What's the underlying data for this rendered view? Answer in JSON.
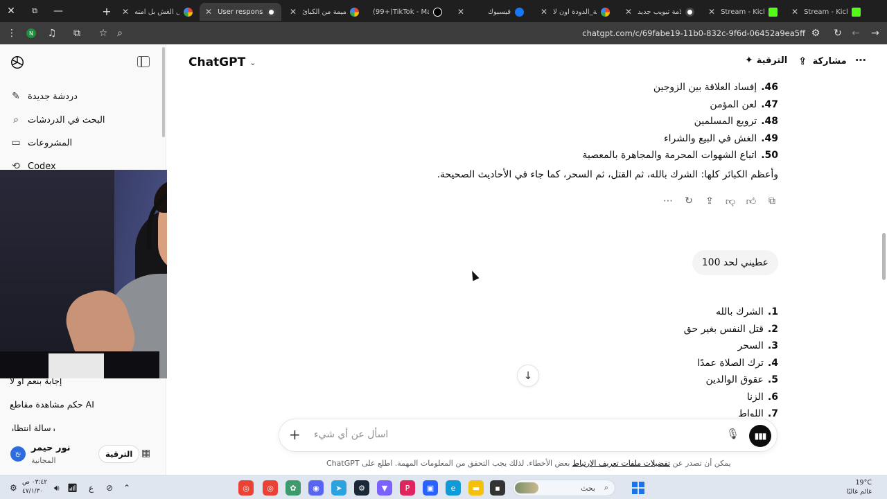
{
  "browser": {
    "close_window_icon": "✕",
    "tabs": [
      {
        "label": "هل الغش بل امته",
        "icon": "g",
        "active": false
      },
      {
        "label": "User response cl",
        "icon": "c",
        "active": true
      },
      {
        "label": "التميمة من الكبائ",
        "icon": "g",
        "active": false
      },
      {
        "label": "(99+)TikTok - Ma",
        "icon": "t",
        "active": false
      },
      {
        "label": "فيسبوك",
        "icon": "f",
        "active": false
      },
      {
        "label": "لعبة_الدودة اون لا",
        "icon": "g",
        "active": false
      },
      {
        "label": "علامة تبويب جديد",
        "icon": "c",
        "active": false
      },
      {
        "label": "Stream - Kick Da",
        "icon": "k",
        "active": false
      },
      {
        "label": "Stream - Kick Da",
        "icon": "k",
        "active": false
      }
    ],
    "url": "chatgpt.com/c/69fabe19-11b0-832c-9f6d-06452a9ea5ff",
    "profile_letter": "N"
  },
  "sidebar": {
    "items": [
      {
        "label": "دردشة جديدة",
        "icon": "✎"
      },
      {
        "label": "البحث في الدردشات",
        "icon": "⌕"
      },
      {
        "label": "المشروعات",
        "icon": "▭"
      },
      {
        "label": "Codex",
        "icon": "⟲"
      }
    ],
    "chats": [
      "إجابة بنعم او لا",
      "حكم مشاهدة مقاطع AI",
      "رسالة انتظار"
    ],
    "user": {
      "name": "نور حيمر",
      "plan": "المجانية",
      "initials": "نح"
    },
    "upgrade_label": "الترقية"
  },
  "header": {
    "model": "ChatGPT",
    "upgrade_label": "الترقية",
    "share_label": "مشاركة"
  },
  "conversation": {
    "list_top": [
      {
        "num": "46.",
        "text": "إفساد العلاقة بين الزوجين"
      },
      {
        "num": "47.",
        "text": "لعن المؤمن"
      },
      {
        "num": "48.",
        "text": "ترويع المسلمين"
      },
      {
        "num": "49.",
        "text": "الغش في البيع والشراء"
      },
      {
        "num": "50.",
        "text": "اتباع الشهوات المحرمة والمجاهرة بالمعصية"
      }
    ],
    "summary": "وأعظم الكبائر كلها: الشرك بالله، ثم القتل، ثم السحر، كما جاء في الأحاديث الصحيحة.",
    "user_message": "عطيني لحد 100",
    "list_bottom": [
      {
        "num": "1.",
        "text": "الشرك بالله"
      },
      {
        "num": "2.",
        "text": "قتل النفس بغير حق"
      },
      {
        "num": "3.",
        "text": "السحر"
      },
      {
        "num": "4.",
        "text": "ترك الصلاة عمدًا"
      },
      {
        "num": "5.",
        "text": "عقوق الوالدين"
      },
      {
        "num": "6.",
        "text": "الزنا"
      },
      {
        "num": "7.",
        "text": "اللواط"
      }
    ]
  },
  "composer": {
    "placeholder": "اسأل عن أي شيء"
  },
  "disclaimer": {
    "before": "ChatGPT يمكن أن تصدر عن",
    "link": "تفضيلات ملفات تعريف الارتباط",
    "after": "بعض الأخطاء. لذلك يجب التحقق من المعلومات المهمة. اطلع على"
  },
  "taskbar": {
    "time": "٠٣:٤٢ ص",
    "date": "٤٧/١/٣٠",
    "lang": "ع",
    "search_label": "بحث",
    "temperature": "19°C",
    "weather": "غائم غالبًا"
  }
}
